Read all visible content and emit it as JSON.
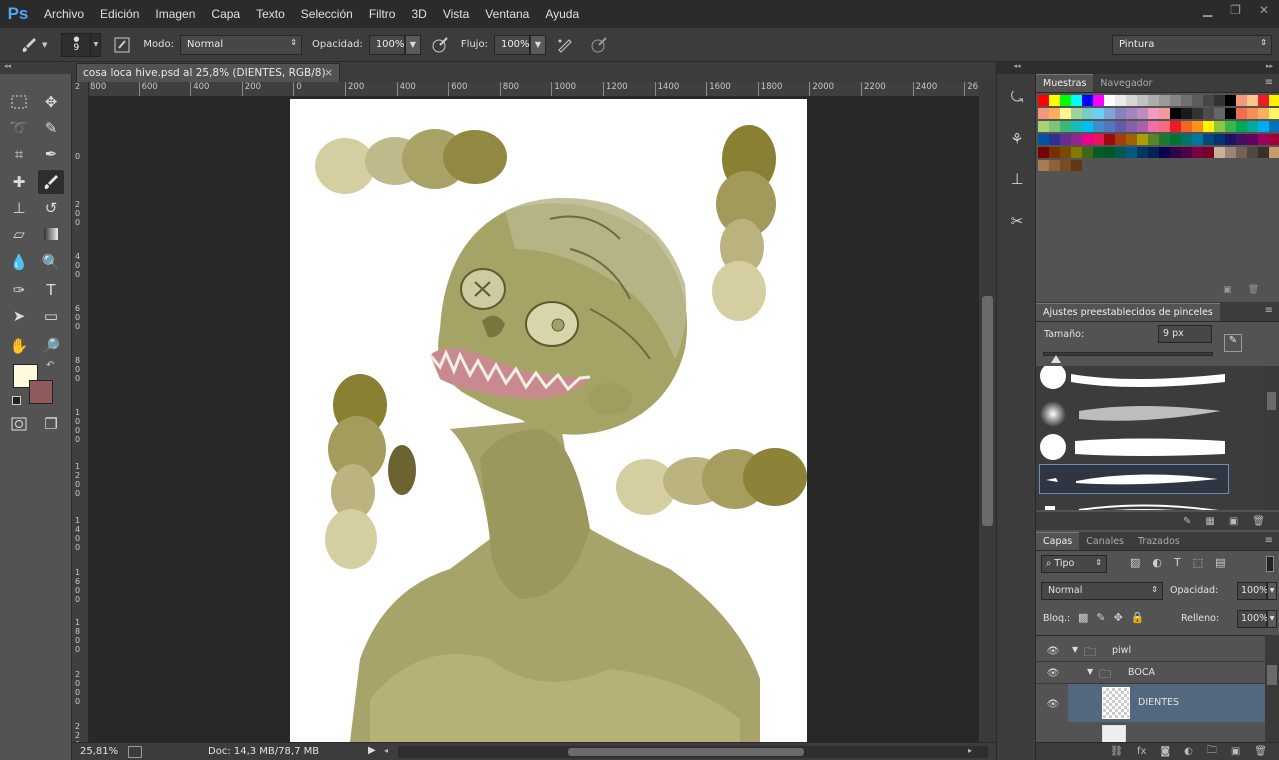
{
  "app": {
    "logo": "Ps"
  },
  "menu": [
    "Archivo",
    "Edición",
    "Imagen",
    "Capa",
    "Texto",
    "Selección",
    "Filtro",
    "3D",
    "Vista",
    "Ventana",
    "Ayuda"
  ],
  "window_controls": {
    "minimize": "▁",
    "restore": "❐",
    "close": "✕"
  },
  "options": {
    "brush_size": "9",
    "mode_label": "Modo:",
    "mode_value": "Normal",
    "opacity_label": "Opacidad:",
    "opacity_value": "100%",
    "flow_label": "Flujo:",
    "flow_value": "100%",
    "workspace": "Pintura"
  },
  "document": {
    "tab_title": "cosa loca hive.psd al 25,8% (DIENTES, RGB/8)",
    "close": "×"
  },
  "ruler": {
    "h_ticks": [
      "800",
      "600",
      "400",
      "200",
      "0",
      "200",
      "400",
      "600",
      "800",
      "1000",
      "1200",
      "1400",
      "1600",
      "1800",
      "2000",
      "2200",
      "2400",
      "26"
    ],
    "v_ticks": [
      "2",
      "0",
      "2 0 0",
      "4 0 0",
      "6 0 0",
      "8 0 0",
      "1 0 0 0",
      "1 2 0 0",
      "1 4 0 0",
      "1 6 0 0",
      "1 8 0 0",
      "2 0 0 0",
      "2 2 0 0"
    ]
  },
  "status": {
    "zoom": "25,81%",
    "doc": "Doc: 14,3 MB/78,7 MB"
  },
  "panels": {
    "swatches_tab": "Muestras",
    "navigator_tab": "Navegador",
    "brush_presets_title": "Ajustes preestablecidos de pinceles",
    "size_label": "Tamaño:",
    "size_value": "9 px",
    "layers_tab": "Capas",
    "channels_tab": "Canales",
    "paths_tab": "Trazados",
    "filter_kind": "Tipo",
    "blend_mode": "Normal",
    "opacity_label": "Opacidad:",
    "opacity_value": "100%",
    "lock_label": "Bloq.:",
    "fill_label": "Relleno:",
    "fill_value": "100%"
  },
  "layers": [
    {
      "name": "piwl",
      "type": "group"
    },
    {
      "name": "BOCA",
      "type": "group"
    },
    {
      "name": "DIENTES",
      "type": "layer",
      "selected": true
    }
  ],
  "colors": {
    "foreground": "#fffbdc",
    "background": "#8f5a5a",
    "accent": "#4ea6f6",
    "selected_layer": "#53677f"
  }
}
